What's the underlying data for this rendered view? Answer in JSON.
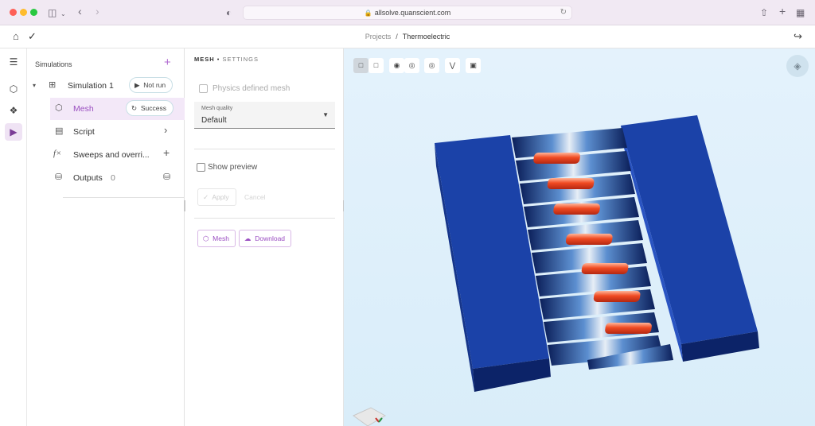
{
  "browser": {
    "url": "allsolve.quanscient.com",
    "icons": [
      "sidebar-icon",
      "back-icon",
      "forward-icon",
      "shield-icon",
      "lock-icon",
      "reload-icon",
      "share-icon",
      "new-tab-icon",
      "tabs-icon"
    ]
  },
  "app": {
    "breadcrumb": {
      "projects": "Projects",
      "separator": "/",
      "current": "Thermoelectric"
    },
    "icons": [
      "home-icon",
      "logo-icon",
      "exit-icon"
    ]
  },
  "tree": {
    "header": "Simulations",
    "add_icon": "plus-icon",
    "simulation": {
      "label": "Simulation 1",
      "status": "Not run"
    },
    "items": [
      {
        "label": "Mesh",
        "status": "Success",
        "icon": "cube-icon"
      },
      {
        "label": "Script",
        "icon": "script-icon"
      },
      {
        "label": "Sweeps and overri...",
        "icon": "function-icon"
      },
      {
        "label": "Outputs",
        "count": "0",
        "icon": "database-icon"
      }
    ]
  },
  "settings": {
    "title_main": "MESH",
    "title_dot": "•",
    "title_sub": "SETTINGS",
    "physics_defined_mesh": "Physics defined mesh",
    "mesh_quality_label": "Mesh quality",
    "mesh_quality_value": "Default",
    "show_preview": "Show preview",
    "apply": "Apply",
    "cancel": "Cancel",
    "mesh_button": "Mesh",
    "download_button": "Download"
  },
  "viewer": {
    "toolbar_icons": [
      "select-box-icon",
      "box-outline-icon",
      "eye-slash-icon",
      "eye-icon",
      "eye-outline-icon",
      "axes-icon",
      "fit-icon"
    ],
    "paint_icon": "paint-bucket-icon",
    "colors": {
      "block": "#1b42a8",
      "hot": "#e84a2a",
      "background": "#ddeef9"
    }
  }
}
